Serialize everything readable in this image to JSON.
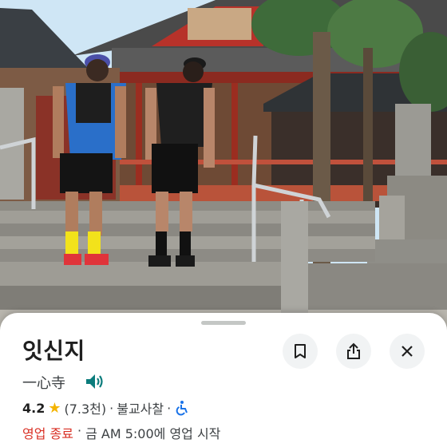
{
  "place": {
    "name": "잇신지",
    "original_name": "一心寺",
    "rating": "4.2",
    "review_count": "(7.3천)",
    "category": "불교사찰",
    "separator": "·",
    "status": "영업 종료",
    "hours_text": "금 AM 5:00에 영업 시작"
  },
  "icons": {
    "speaker": "volume-icon",
    "save": "bookmark-icon",
    "share": "share-icon",
    "close": "close-icon",
    "accessible": "wheelchair-icon",
    "star": "star-icon"
  },
  "colors": {
    "accent": "#0b7c7c",
    "closed": "#d93025",
    "star": "#f4b400",
    "accessible": "#1a73e8"
  }
}
